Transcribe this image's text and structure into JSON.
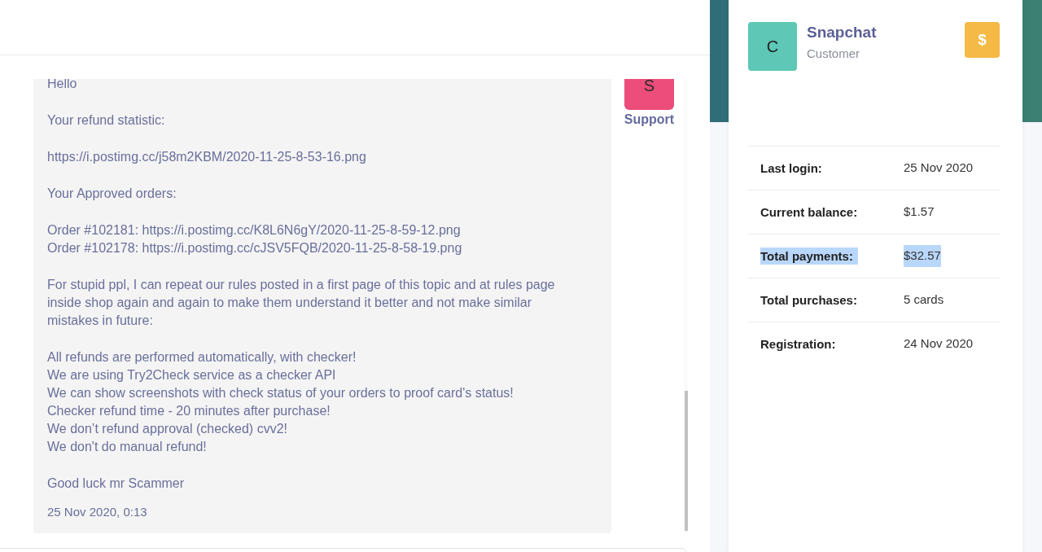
{
  "message": {
    "paragraphs": [
      {
        "lines": [
          "Hello"
        ]
      },
      {
        "lines": [
          "Your refund statistic:"
        ]
      },
      {
        "lines": [
          "https://i.postimg.cc/j58m2KBM/2020-11-25-8-53-16.png"
        ]
      },
      {
        "lines": [
          "Your Approved orders:"
        ]
      },
      {
        "lines": [
          "Order #102181: https://i.postimg.cc/K8L6N6gY/2020-11-25-8-59-12.png",
          "Order #102178: https://i.postimg.cc/cJSV5FQB/2020-11-25-8-58-19.png"
        ]
      },
      {
        "lines": [
          "For stupid ppl, I can repeat our rules posted in a first page of this topic and at rules page",
          "inside shop again and again to make them understand it better and not make similar",
          "mistakes in future:"
        ]
      },
      {
        "lines": [
          "All refunds are performed automatically, with checker!",
          "We are using Try2Check service as a checker API",
          "We can show screenshots with check status of your orders to proof card's status!",
          "Checker refund time - 20 minutes after purchase!",
          "We don’t refund approval (checked) cvv2!",
          "We don't do manual refund!"
        ]
      },
      {
        "lines": [
          "Good luck mr Scammer"
        ]
      }
    ],
    "time": "25 Nov 2020, 0:13",
    "author": {
      "initial": "S",
      "name": "Support"
    }
  },
  "profile": {
    "initial": "C",
    "name": "Snapchat",
    "role": "Customer",
    "action": {
      "label": "$"
    }
  },
  "stats": [
    {
      "label": "Last login:",
      "value": "25 Nov 2020",
      "highlighted": false
    },
    {
      "label": "Current balance:",
      "value": "$1.57",
      "highlighted": false
    },
    {
      "label": "Total payments:",
      "value": "$32.57",
      "highlighted": true
    },
    {
      "label": "Total purchases:",
      "value": "5 cards",
      "highlighted": false
    },
    {
      "label": "Registration:",
      "value": "24 Nov 2020",
      "highlighted": false
    }
  ]
}
